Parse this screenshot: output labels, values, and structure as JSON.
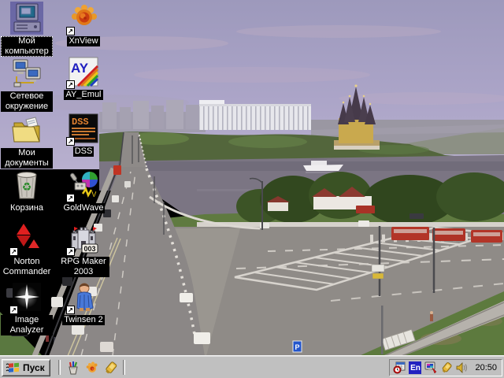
{
  "wallpaper": {
    "description": "Summer daytime photo of a river city (webcam view): a long bridge with car traffic crosses the river from lower-left; far bank has apartment blocks, a long white stadium and a gold cathedral with dark tented spires; a white ship on the water; tree-lined embankment; large asphalt intersection with painted chevron island, red buses parked at right, grass and a concrete ramp in the near corners",
    "colors": {
      "sky": "#a8a2c6",
      "river": "#7b7583",
      "pavement": "#8f8b87",
      "trees": "#53663c",
      "cathedral_gold": "#c9a94e",
      "bus_red": "#b23528"
    }
  },
  "desktop": {
    "icons": [
      {
        "id": "my-computer",
        "label": "Мой компьютер",
        "shortcut": false,
        "selected": true
      },
      {
        "id": "xnview",
        "label": "XnView",
        "shortcut": true,
        "selected": false
      },
      {
        "id": "network",
        "label": "Сетевое окружение",
        "shortcut": false,
        "selected": false
      },
      {
        "id": "ay-emul",
        "label": "AY_Emul",
        "shortcut": true,
        "selected": false
      },
      {
        "id": "my-documents",
        "label": "Мои документы",
        "shortcut": false,
        "selected": false
      },
      {
        "id": "dss",
        "label": "DSS",
        "shortcut": true,
        "selected": false
      },
      {
        "id": "recycle-bin",
        "label": "Корзина",
        "shortcut": false,
        "selected": false
      },
      {
        "id": "goldwave",
        "label": "GoldWave",
        "shortcut": true,
        "selected": false
      },
      {
        "id": "norton",
        "label": "Norton Commander",
        "shortcut": true,
        "selected": false
      },
      {
        "id": "rpg-maker",
        "label": "RPG Maker 2003",
        "shortcut": true,
        "selected": false
      },
      {
        "id": "image-analyzer",
        "label": "Image Analyzer",
        "shortcut": true,
        "selected": false
      },
      {
        "id": "twinsen",
        "label": "Twinsen 2",
        "shortcut": true,
        "selected": false
      }
    ]
  },
  "taskbar": {
    "start": {
      "label": "Пуск",
      "icon": "windows-logo-icon"
    },
    "quick_launch": [
      {
        "icon": "pen-cup-icon"
      },
      {
        "icon": "xnview-spiral-icon"
      },
      {
        "icon": "gold-brush-icon"
      }
    ],
    "tray": {
      "icons": [
        {
          "icon": "scheduler-icon"
        },
        {
          "icon": "keyboard-layout-indicator",
          "label": "En"
        },
        {
          "icon": "display-settings-icon"
        },
        {
          "icon": "gold-brush-icon"
        },
        {
          "icon": "volume-icon"
        }
      ],
      "clock": "20:50"
    }
  }
}
